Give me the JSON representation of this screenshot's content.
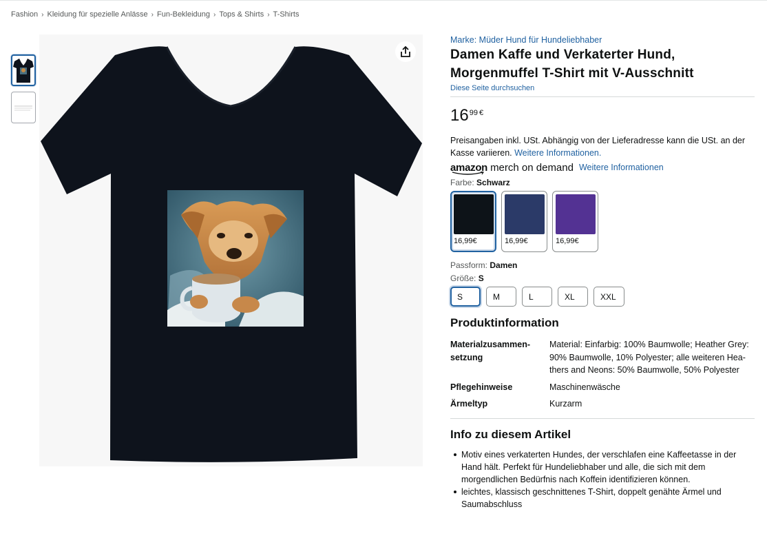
{
  "breadcrumb": [
    "Fashion",
    "Kleidung für spezielle Anlässe",
    "Fun-Bekleidung",
    "Tops & Shirts",
    "T-Shirts"
  ],
  "product": {
    "brand": "Marke: Müder Hund für Hundeliebhaber",
    "title": "Damen Kaffe und Verkaterter Hund, Morgenmuffel T-Shirt mit V-Ausschnitt",
    "store_link": "Diese Seite durchsuchen",
    "price_whole": "16",
    "price_fraction": "99",
    "price_currency": "€",
    "tax_text": "Preisangaben inkl. USt. Abhängig von der Lieferadresse kann die USt. an der Kasse variieren.",
    "tax_link": "Weitere Informationen.",
    "merch_amazon": "amazon",
    "merch_text": "merch on demand",
    "merch_link": "Weitere Informationen"
  },
  "color": {
    "label": "Farbe:",
    "selected": "Schwarz",
    "options": [
      {
        "hex": "#0d1318",
        "price": "16,99€"
      },
      {
        "hex": "#2b3a68",
        "price": "16,99€"
      },
      {
        "hex": "#533293",
        "price": "16,99€"
      }
    ]
  },
  "fit": {
    "label": "Passform:",
    "value": "Damen"
  },
  "size": {
    "label": "Größe:",
    "selected": "S",
    "options": [
      "S",
      "M",
      "L",
      "XL",
      "XXL"
    ]
  },
  "product_info": {
    "heading": "Produktinformation",
    "rows": [
      {
        "key": "Materialzusammen-setzung",
        "value": "Material: Einfarbig: 100% Baumwolle; Heather Grey: 90% Baumwolle, 10% Polyester; alle weiteren Hea-thers and Neons: 50% Baumwolle, 50% Polyester"
      },
      {
        "key": "Pflegehinweise",
        "value": "Maschinenwäsche"
      },
      {
        "key": "Ärmeltyp",
        "value": "Kurzarm"
      }
    ]
  },
  "about": {
    "heading": "Info zu diesem Artikel",
    "bullets": [
      "Motiv eines verkaterten Hundes, der verschlafen eine Kaffeetasse in der Hand hält. Perfekt für Hundeliebhaber und alle, die sich mit dem morgendlichen Bedürfnis nach Koffein identifizieren können.",
      "leichtes, klassisch geschnittenes T-Shirt, doppelt genähte Ärmel und Saumabschluss"
    ]
  },
  "icons": {
    "share": "share-icon"
  },
  "colors": {
    "link": "#2162a1",
    "text": "#0f1111",
    "muted": "#565959",
    "selected_border": "#2162a1",
    "shirt": "#0e131c"
  }
}
